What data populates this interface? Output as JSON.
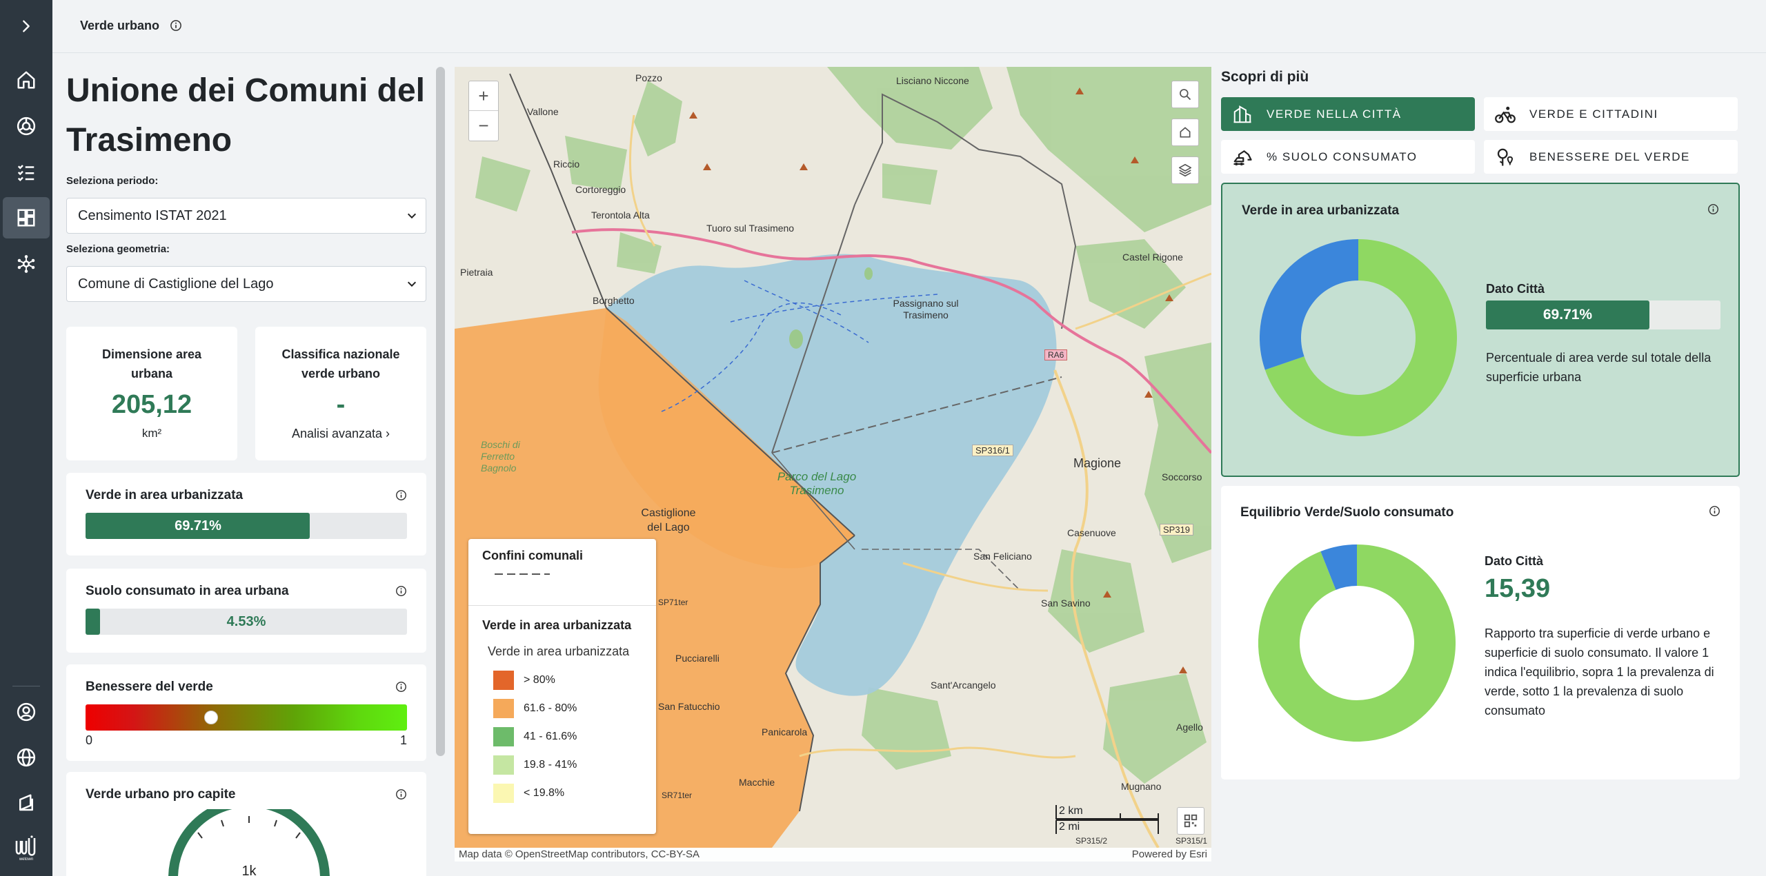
{
  "app": {
    "page_title": "Verde urbano"
  },
  "sidebar": {
    "items": [
      {
        "name": "home",
        "icon": "home-icon"
      },
      {
        "name": "explore",
        "icon": "compass-icon"
      },
      {
        "name": "tasks",
        "icon": "checklist-icon"
      },
      {
        "name": "dashboard",
        "icon": "dashboard-icon",
        "active": true
      },
      {
        "name": "hub",
        "icon": "hub-icon"
      },
      {
        "name": "account",
        "icon": "user-circle-icon"
      },
      {
        "name": "language",
        "icon": "globe-icon"
      },
      {
        "name": "catalog",
        "icon": "book-icon"
      },
      {
        "name": "logo",
        "icon": "logo-icon"
      }
    ]
  },
  "left": {
    "heading": "Unione dei Comuni del Trasimeno",
    "period_label": "Seleziona periodo:",
    "period_value": "Censimento ISTAT 2021",
    "geometry_label": "Seleziona geometria:",
    "geometry_value": "Comune di Castiglione del Lago",
    "stats": {
      "area": {
        "label": "Dimensione area urbana",
        "value": "205,12",
        "unit": "km²"
      },
      "rank": {
        "label": "Classifica nazionale verde urbano",
        "value": "-",
        "link": "Analisi avanzata ›"
      }
    },
    "indicators": {
      "verde": {
        "title": "Verde in area urbanizzata",
        "value": "69.71%",
        "fraction": 0.6971
      },
      "suolo": {
        "title": "Suolo consumato in area urbana",
        "value": "4.53%",
        "fraction": 0.0453
      },
      "benessere": {
        "title": "Benessere del verde",
        "min": "0",
        "max": "1",
        "level": 0.39
      },
      "procapite": {
        "title": "Verde urbano pro capite",
        "gauge_label": "1k"
      }
    }
  },
  "map": {
    "zoom_in": "+",
    "zoom_out": "−",
    "legend": {
      "section1_title": "Confini comunali",
      "section2_title": "Verde in area urbanizzata",
      "section2_sub": "Verde in area urbanizzata",
      "items": [
        {
          "label": "> 80%",
          "color": "#e3662a"
        },
        {
          "label": "61.6 - 80%",
          "color": "#f5a95a"
        },
        {
          "label": "41 - 61.6%",
          "color": "#6dbb6a"
        },
        {
          "label": "19.8 - 41%",
          "color": "#c5e6a2"
        },
        {
          "label": "< 19.8%",
          "color": "#fbf7b2"
        }
      ]
    },
    "labels": {
      "pozzo": "Pozzo",
      "lisciano": "Lisciano Niccone",
      "vallone": "Vallone",
      "riccio": "Riccio",
      "cortoreggio": "Cortoreggio",
      "terontola": "Terontola Alta",
      "tuoro": "Tuoro sul Trasimeno",
      "pietraia": "Pietraia",
      "borghetto": "Borghetto",
      "passignano": "Passignano sul Trasimeno",
      "castel_rigone": "Castel Rigone",
      "ra6": "RA6",
      "magione": "Magione",
      "sp316": "SP316/1",
      "socorso": "Soccorso",
      "parco": "Parco del Lago Trasimeno",
      "castiglione": "Castiglione del Lago",
      "casenuove": "Casenuove",
      "sp319": "SP319",
      "san_feliciano": "San Feliciano",
      "san_savino": "San Savino",
      "sant_arcangelo": "Sant'Arcangelo",
      "pucciarelli": "Pucciarelli",
      "san_fatucchio": "San Fatucchio",
      "panicarola": "Panicarola",
      "macchie": "Macchie",
      "agello": "Agello",
      "mugnano": "Mugnano",
      "boschi": "Boschi di Ferretto Bagnolo",
      "sp71": "SP71ter",
      "sp71b": "SR71ter",
      "sp315": "SP315/2",
      "sp315b": "SP315/1"
    },
    "scale_km": "2 km",
    "scale_mi": "2 mi",
    "attribution": "Map data © OpenStreetMap contributors, CC-BY-SA",
    "powered": "Powered by Esri"
  },
  "right": {
    "scopri_title": "Scopri di più",
    "tabs": [
      {
        "label": "VERDE NELLA CITTÀ",
        "icon": "building-icon",
        "active": true
      },
      {
        "label": "VERDE E CITTADINI",
        "icon": "cyclist-icon"
      },
      {
        "label": "% SUOLO CONSUMATO",
        "icon": "excavator-icon"
      },
      {
        "label": "BENESSERE DEL VERDE",
        "icon": "wellness-tree-icon"
      }
    ],
    "card1": {
      "title": "Verde in area urbanizzata",
      "dato_label": "Dato Città",
      "dato_value": "69.71%",
      "fraction": 0.6971,
      "description": "Percentuale di area verde sul totale della superficie urbana",
      "colors": {
        "green": "#8fd862",
        "blue": "#3b86db"
      }
    },
    "card2": {
      "title": "Equilibrio Verde/Suolo consumato",
      "dato_label": "Dato Città",
      "dato_value": "15,39",
      "blue_fraction": 0.06,
      "description": "Rapporto tra superficie di verde urbano e superficie di suolo consumato. Il valore 1 indica l'equilibrio, sopra 1 la prevalenza di verde, sotto 1 la prevalenza di suolo consumato"
    }
  },
  "colors": {
    "brand_green": "#2f7a57",
    "sidebar": "#2d3740",
    "lake": "#a4cbdb",
    "commune_fill": "#f5a95a"
  }
}
